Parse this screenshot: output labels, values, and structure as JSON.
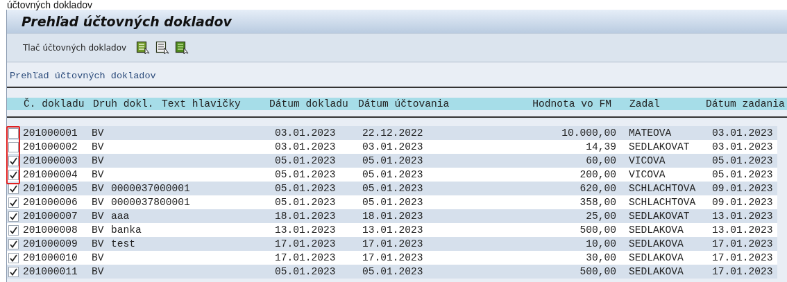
{
  "caption": "účtovných dokladov",
  "title": "Prehľad účtovných dokladov",
  "toolbar": {
    "label": "Tlač účtovných dokladov"
  },
  "list_title": "Prehľad účtovných dokladov",
  "table": {
    "columns": [
      "Č. dokladu",
      "Druh dokl.",
      "Text hlavičky",
      "Dátum dokladu",
      "Dátum účtovania",
      "Hodnota vo FM",
      "Zadal",
      "Dátum zadania"
    ],
    "rows": [
      {
        "checked": false,
        "doc_number": "201000001",
        "doc_type": "BV",
        "doc_date": "03.01.2023",
        "posting_date": "22.12.2022",
        "amount": "10.000,00",
        "entered_by": "MATEOVA",
        "entry_date": "03.01.2023"
      },
      {
        "checked": false,
        "doc_number": "201000002",
        "doc_type": "BV",
        "doc_date": "03.01.2023",
        "posting_date": "03.01.2023",
        "amount": "14,39",
        "entered_by": "SEDLAKOVAT",
        "entry_date": "03.01.2023"
      },
      {
        "checked": true,
        "doc_number": "201000003",
        "doc_type": "BV",
        "doc_date": "05.01.2023",
        "posting_date": "05.01.2023",
        "amount": "60,00",
        "entered_by": "VICOVA",
        "entry_date": "05.01.2023"
      },
      {
        "checked": true,
        "doc_number": "201000004",
        "doc_type": "BV",
        "doc_date": "05.01.2023",
        "posting_date": "05.01.2023",
        "amount": "200,00",
        "entered_by": "VICOVA",
        "entry_date": "05.01.2023"
      },
      {
        "checked": true,
        "doc_number": "201000005",
        "doc_type": "BV",
        "header_text": "0000037000001",
        "doc_date": "05.01.2023",
        "posting_date": "05.01.2023",
        "amount": "620,00",
        "entered_by": "SCHLACHTOVA",
        "entry_date": "09.01.2023"
      },
      {
        "checked": true,
        "doc_number": "201000006",
        "doc_type": "BV",
        "header_text": "0000037800001",
        "doc_date": "05.01.2023",
        "posting_date": "05.01.2023",
        "amount": "358,00",
        "entered_by": "SCHLACHTOVA",
        "entry_date": "09.01.2023"
      },
      {
        "checked": true,
        "doc_number": "201000007",
        "doc_type": "BV",
        "header_text": "aaa",
        "doc_date": "18.01.2023",
        "posting_date": "18.01.2023",
        "amount": "25,00",
        "entered_by": "SEDLAKOVAT",
        "entry_date": "13.01.2023"
      },
      {
        "checked": true,
        "doc_number": "201000008",
        "doc_type": "BV",
        "header_text": "banka",
        "doc_date": "13.01.2023",
        "posting_date": "13.01.2023",
        "amount": "500,00",
        "entered_by": "SEDLAKOVA",
        "entry_date": "13.01.2023"
      },
      {
        "checked": true,
        "doc_number": "201000009",
        "doc_type": "BV",
        "header_text": "test",
        "doc_date": "17.01.2023",
        "posting_date": "17.01.2023",
        "amount": "10,00",
        "entered_by": "SEDLAKOVA",
        "entry_date": "17.01.2023"
      },
      {
        "checked": true,
        "doc_number": "201000010",
        "doc_type": "BV",
        "doc_date": "17.01.2023",
        "posting_date": "17.01.2023",
        "amount": "30,00",
        "entered_by": "SEDLAKOVA",
        "entry_date": "17.01.2023"
      },
      {
        "checked": true,
        "doc_number": "201000011",
        "doc_type": "BV",
        "doc_date": "05.01.2023",
        "posting_date": "05.01.2023",
        "amount": "500,00",
        "entered_by": "SEDLAKOVA",
        "entry_date": "17.01.2023"
      }
    ]
  }
}
